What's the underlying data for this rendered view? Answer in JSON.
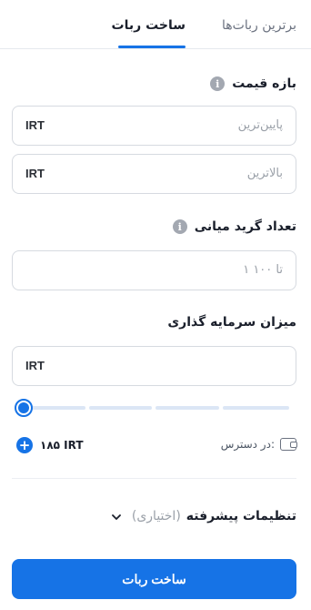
{
  "tabs": [
    {
      "label": "برترین ربات‌ها",
      "active": false
    },
    {
      "label": "ساخت ربات",
      "active": true
    }
  ],
  "price_range": {
    "label": "بازه قیمت",
    "min_placeholder": "پایین‌ترین",
    "max_placeholder": "بالاترین",
    "unit": "IRT"
  },
  "grid": {
    "label": "تعداد گرید میانی",
    "placeholder": "۱ تا ۱۰۰"
  },
  "investment": {
    "label": "میزان سرمایه گذاری",
    "unit": "IRT",
    "slider_value": 0,
    "available_label": "در دسترس:",
    "available_amount": "۱۸۵ IRT"
  },
  "advanced": {
    "title": "تنظیمات پیشرفته",
    "optional": "(اختیاری)"
  },
  "submit_label": "ساخت ربات",
  "colors": {
    "accent": "#1673e6",
    "muted": "#9aa0a8"
  }
}
